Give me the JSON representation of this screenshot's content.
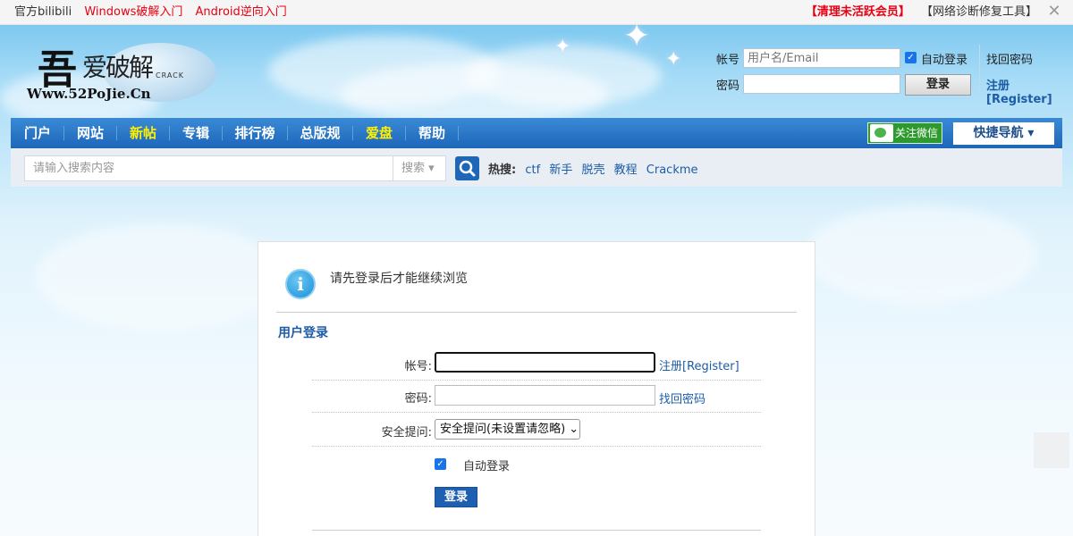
{
  "topbar": {
    "links_left": [
      "官方bilibili",
      "Windows破解入门",
      "Android逆向入门"
    ],
    "link_right_bold": "【清理未活跃会员】",
    "link_right": "【网络诊断修复工具】"
  },
  "logo": {
    "big": "吾",
    "mid": "爱破解",
    "crack": "CRACK",
    "url": "Www.52PoJie.Cn"
  },
  "header_login": {
    "account_label": "帐号",
    "account_placeholder": "用户名/Email",
    "password_label": "密码",
    "auto_login": "自动登录",
    "login_button": "登录",
    "find_password": "找回密码",
    "register": "注册[Register]"
  },
  "nav": {
    "items": [
      "门户",
      "网站",
      "新帖",
      "专辑",
      "排行榜",
      "总版规",
      "爱盘",
      "帮助"
    ],
    "wechat": "关注微信",
    "quick_nav": "快捷导航 ▾"
  },
  "search": {
    "placeholder": "请输入搜索内容",
    "select": "搜索 ▾",
    "hot_label": "热搜:",
    "hot_keywords": [
      "ctf",
      "新手",
      "脱壳",
      "教程",
      "Crackme"
    ]
  },
  "panel": {
    "notice": "请先登录后才能继续浏览",
    "section_title": "用户登录",
    "account_label": "帐号:",
    "register_link": "注册[Register]",
    "password_label": "密码:",
    "find_password_link": "找回密码",
    "security_label": "安全提问:",
    "security_select": "安全提问(未设置请忽略) ⌄",
    "auto_login": "自动登录",
    "login_button": "登录"
  }
}
